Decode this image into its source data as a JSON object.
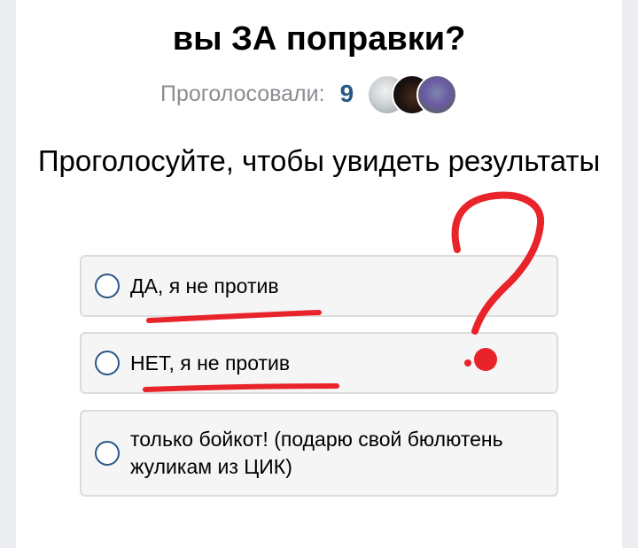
{
  "poll": {
    "title": "вы ЗА поправки?",
    "voted_label": "Проголосовали:",
    "voted_count": "9",
    "prompt": "Проголосуйте, чтобы увидеть результаты",
    "options": [
      {
        "label": "ДА, я не против"
      },
      {
        "label": "НЕТ, я не против"
      },
      {
        "label": "только бойкот! (подарю свой бюлютень жуликам из ЦИК)"
      }
    ]
  },
  "colors": {
    "accent": "#2a5885",
    "muted_text": "#8a8d91",
    "option_bg": "#f5f5f5",
    "option_border": "#dcdcdc",
    "annotation": "#e8242a"
  },
  "icons": {
    "avatars": [
      "avatar-1",
      "avatar-2",
      "avatar-3"
    ],
    "radio": "radio-unselected-icon",
    "annotation_mark": "red-question-mark-doodle"
  }
}
